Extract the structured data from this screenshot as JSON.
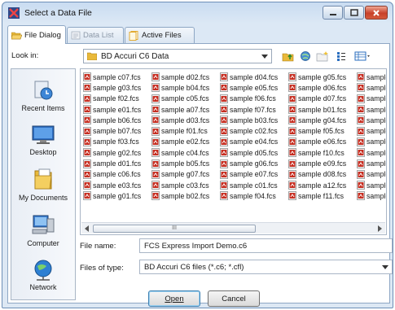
{
  "window": {
    "title": "Select a Data File",
    "colors": {
      "accent": "#3c7fb1",
      "fcs_icon": "#c62d20",
      "folder": "#e9b93a"
    }
  },
  "tabs": [
    {
      "label": "File Dialog",
      "icon": "folder-open-icon",
      "active": true
    },
    {
      "label": "Data List",
      "icon": "data-list-icon",
      "disabled": true
    },
    {
      "label": "Active Files",
      "icon": "files-icon"
    }
  ],
  "lookin": {
    "label": "Look in:",
    "value": "BD Accuri C6 Data"
  },
  "places": [
    {
      "label": "Recent Items",
      "icon": "recent-items-icon"
    },
    {
      "label": "Desktop",
      "icon": "desktop-icon"
    },
    {
      "label": "My Documents",
      "icon": "documents-icon"
    },
    {
      "label": "Computer",
      "icon": "computer-icon"
    },
    {
      "label": "Network",
      "icon": "network-icon"
    }
  ],
  "files": [
    [
      "sample c07.fcs",
      "sample d02.fcs",
      "sample d04.fcs",
      "sample g05.fcs",
      "sample"
    ],
    [
      "sample g03.fcs",
      "sample b04.fcs",
      "sample e05.fcs",
      "sample d06.fcs",
      "sample"
    ],
    [
      "sample f02.fcs",
      "sample c05.fcs",
      "sample f06.fcs",
      "sample d07.fcs",
      "sample"
    ],
    [
      "sample e01.fcs",
      "sample a07.fcs",
      "sample f07.fcs",
      "sample b01.fcs",
      "sample"
    ],
    [
      "sample b06.fcs",
      "sample d03.fcs",
      "sample b03.fcs",
      "sample g04.fcs",
      "sample"
    ],
    [
      "sample b07.fcs",
      "sample f01.fcs",
      "sample c02.fcs",
      "sample f05.fcs",
      "sample"
    ],
    [
      "sample f03.fcs",
      "sample e02.fcs",
      "sample e04.fcs",
      "sample e06.fcs",
      "sample"
    ],
    [
      "sample g02.fcs",
      "sample c04.fcs",
      "sample d05.fcs",
      "sample f10.fcs",
      "sample"
    ],
    [
      "sample d01.fcs",
      "sample b05.fcs",
      "sample g06.fcs",
      "sample e09.fcs",
      "sample"
    ],
    [
      "sample c06.fcs",
      "sample g07.fcs",
      "sample e07.fcs",
      "sample d08.fcs",
      "sample"
    ],
    [
      "sample e03.fcs",
      "sample c03.fcs",
      "sample c01.fcs",
      "sample a12.fcs",
      "sample"
    ],
    [
      "sample g01.fcs",
      "sample b02.fcs",
      "sample f04.fcs",
      "sample f11.fcs",
      "sample"
    ]
  ],
  "scrollbar": {
    "thumb_grip": "III"
  },
  "file_name": {
    "label": "File name:",
    "value": "FCS Express Import Demo.c6"
  },
  "file_type": {
    "label": "Files of type:",
    "value": "BD Accuri C6 files (*.c6; *.cfl)"
  },
  "buttons": {
    "open": "Open",
    "cancel": "Cancel"
  }
}
